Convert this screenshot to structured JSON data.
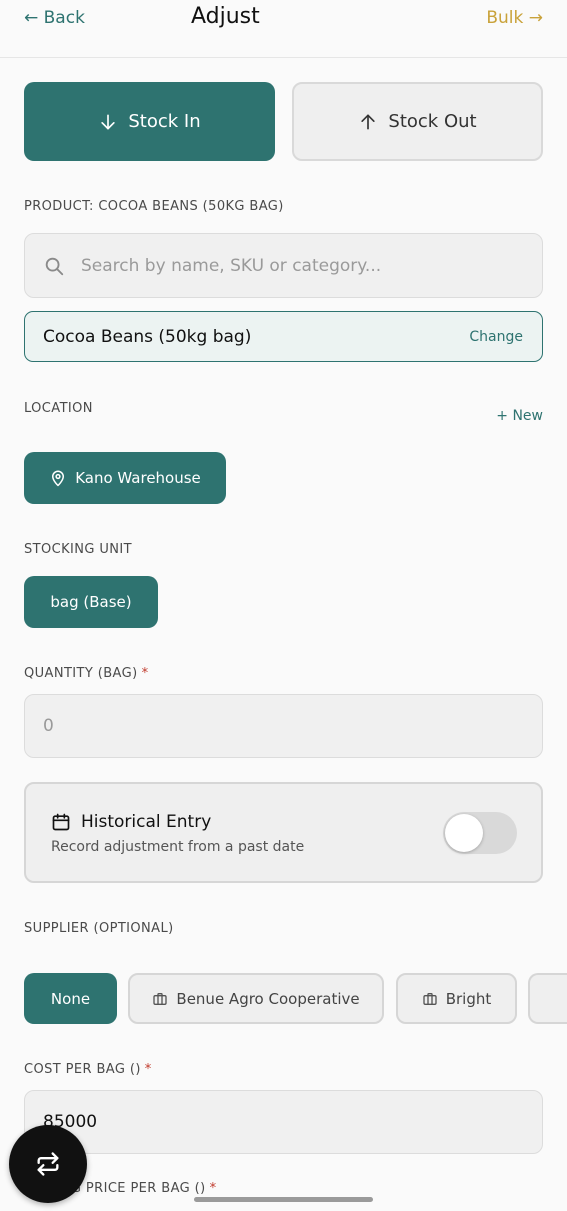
{
  "header": {
    "back_label": "← Back",
    "title": "Adjust",
    "bulk_label": "Bulk →"
  },
  "mode": {
    "stock_in_label": "Stock In",
    "stock_out_label": "Stock Out",
    "selected": "Stock In"
  },
  "product": {
    "section_label": "PRODUCT: COCOA BEANS (50KG BAG)",
    "search_placeholder": "Search by name, SKU or category...",
    "selected_name": "Cocoa Beans (50kg bag)",
    "change_label": "Change"
  },
  "location": {
    "section_label": "LOCATION",
    "new_label": "+ New",
    "selected": "Kano Warehouse"
  },
  "stocking_unit": {
    "section_label": "STOCKING UNIT",
    "selected": "bag (Base)"
  },
  "quantity": {
    "section_label": "QUANTITY (BAG)",
    "required_mark": "*",
    "placeholder": "0"
  },
  "historical": {
    "title": "Historical Entry",
    "subtitle": "Record adjustment from a past date",
    "enabled": false
  },
  "supplier": {
    "section_label": "SUPPLIER (OPTIONAL)",
    "options": [
      "None",
      "Benue Agro Cooperative",
      "Bright"
    ],
    "selected": "None"
  },
  "cost": {
    "section_label": "COST PER BAG ()",
    "required_mark": "*",
    "value": "85000"
  },
  "selling_price": {
    "section_label": "SELLING PRICE PER BAG ()",
    "required_mark": "*"
  },
  "colors": {
    "accent": "#2e7370",
    "bulk": "#c9a23a",
    "required": "#c0392b"
  }
}
